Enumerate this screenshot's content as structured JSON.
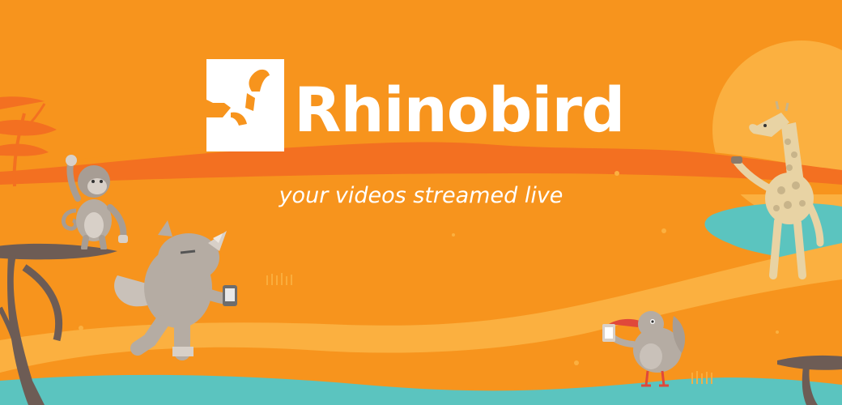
{
  "brand": {
    "name": "Rhinobird",
    "tagline": "your videos streamed live"
  },
  "icons": [
    "rhinobird-logo-icon",
    "monkey-illustration",
    "rhino-illustration",
    "bird-illustration",
    "giraffe-illustration",
    "sun-shape",
    "acacia-tree-icon"
  ],
  "colors": {
    "background": "#f7941d",
    "band": "#f37021",
    "path": "#fbb040",
    "water": "#5bc4bf",
    "sun": "#fbb040",
    "text": "#ffffff",
    "animal_grey": "#b5aca3",
    "tree_trunk": "#6d5c55"
  }
}
